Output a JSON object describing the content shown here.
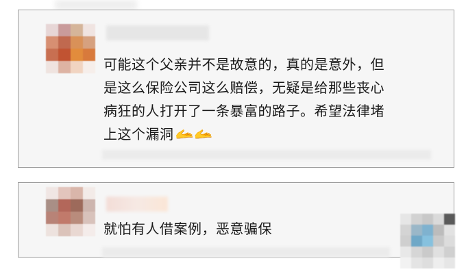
{
  "comments": [
    {
      "lines": [
        "可能这个父亲并不是故意的，真的是意外，但",
        "是这么保险公司这么赔偿，无疑是给那些丧心",
        "病狂的人打开了一条暴富的路子。希望法律堵",
        "上这个漏洞"
      ],
      "emoji": "🫴🫴"
    },
    {
      "lines": [
        "就怕有人借案例，恶意骗保"
      ]
    }
  ]
}
